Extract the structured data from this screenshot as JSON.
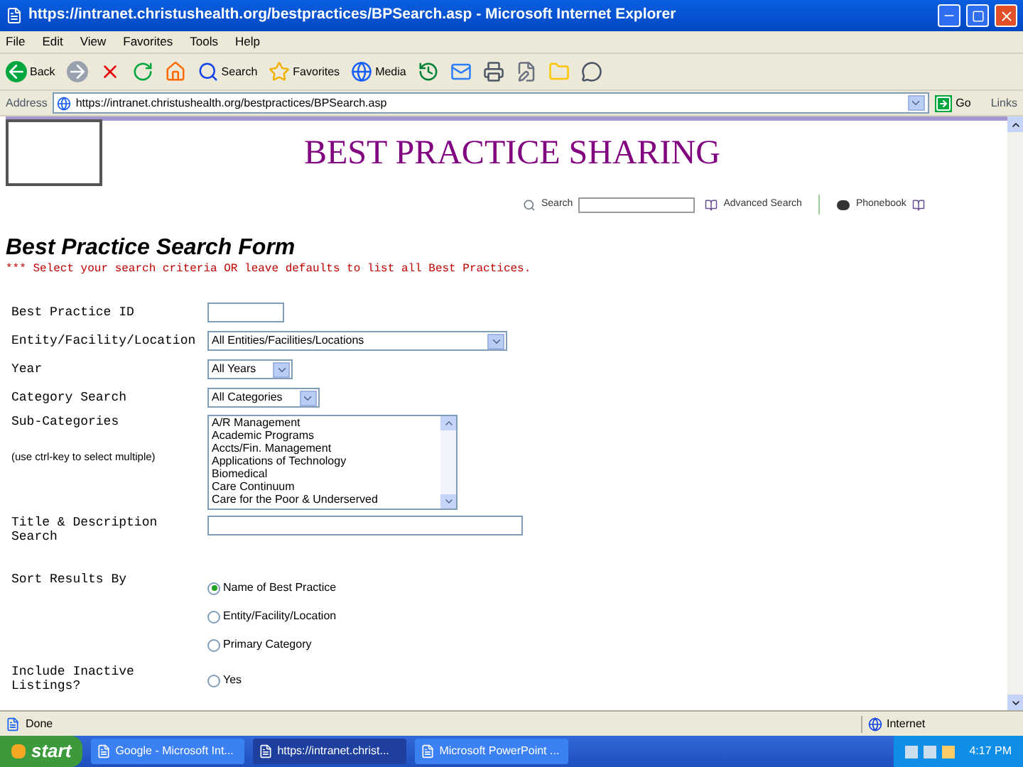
{
  "window": {
    "title": "https://intranet.christushealth.org/bestpractices/BPSearch.asp - Microsoft Internet Explorer"
  },
  "menu": [
    "File",
    "Edit",
    "View",
    "Favorites",
    "Tools",
    "Help"
  ],
  "toolbar": [
    {
      "kind": "back",
      "label": "Back"
    },
    {
      "kind": "forward"
    },
    {
      "kind": "stop"
    },
    {
      "kind": "refresh"
    },
    {
      "kind": "home"
    },
    {
      "kind": "search",
      "label": "Search"
    },
    {
      "kind": "favorites",
      "label": "Favorites"
    },
    {
      "kind": "media",
      "label": "Media"
    },
    {
      "kind": "history"
    },
    {
      "kind": "mail"
    },
    {
      "kind": "print"
    },
    {
      "kind": "edit"
    },
    {
      "kind": "folder"
    },
    {
      "kind": "messenger"
    }
  ],
  "address": {
    "label": "Address",
    "url": "https://intranet.christushealth.org/bestpractices/BPSearch.asp",
    "go": "Go",
    "links": "Links"
  },
  "banner": {
    "title": "BEST PRACTICE SHARING"
  },
  "site_search": {
    "label": "Search",
    "advanced": "Advanced Search",
    "phonebook": "Phonebook"
  },
  "form": {
    "title": "Best Practice Search Form",
    "note": "*** Select your search criteria OR leave defaults to list all Best Practices.",
    "fields": [
      {
        "kind": "text",
        "label": "Best Practice ID"
      },
      {
        "kind": "select",
        "label": "Entity/Facility/Location",
        "value": "All Entities/Facilities/Locations"
      },
      {
        "kind": "select",
        "label": "Year",
        "value": "All Years"
      },
      {
        "kind": "select",
        "label": "Category Search",
        "value": "All Categories"
      },
      {
        "kind": "listbox",
        "label": "Sub-Categories",
        "hint": "(use ctrl-key to select multiple)",
        "options": [
          "A/R Management",
          "Academic Programs",
          "Accts/Fin. Management",
          "Applications of Technology",
          "Biomedical",
          "Care Continuum",
          "Care for the Poor & Underserved"
        ]
      },
      {
        "kind": "wide_text",
        "label": "Title & Description Search"
      },
      {
        "kind": "radio",
        "label": "Sort Results By",
        "options": [
          {
            "label": "Name of Best Practice",
            "selected": true
          },
          {
            "label": "Entity/Facility/Location",
            "selected": false
          },
          {
            "label": "Primary Category",
            "selected": false
          }
        ]
      },
      {
        "kind": "radio",
        "label": "Include Inactive Listings?",
        "options": [
          {
            "label": "Yes",
            "selected": false
          }
        ]
      }
    ]
  },
  "status_bar": {
    "status": "Done",
    "zone": "Internet"
  },
  "taskbar": {
    "start": "start",
    "tasks": [
      {
        "label": "Google - Microsoft Int...",
        "selected": false
      },
      {
        "label": "https://intranet.christ...",
        "selected": true
      },
      {
        "label": "Microsoft PowerPoint ...",
        "selected": false
      }
    ],
    "clock": "4:17 PM"
  }
}
